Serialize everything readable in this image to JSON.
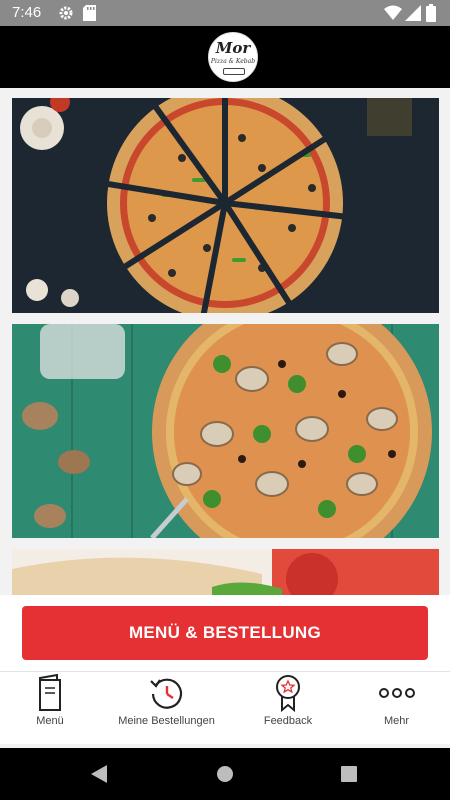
{
  "status_bar": {
    "time": "7:46",
    "icons": [
      "settings-icon",
      "sd-card-icon",
      "wifi-icon",
      "signal-icon",
      "battery-icon"
    ]
  },
  "header": {
    "logo": {
      "name": "Mor",
      "subtitle": "Pizza & Kebab"
    }
  },
  "content": {
    "cards": [
      {
        "name": "pizza-slices-photo"
      },
      {
        "name": "mushroom-pizza-photo"
      },
      {
        "name": "wrap-photo"
      }
    ]
  },
  "cta": {
    "label": "MENÜ & BESTELLUNG",
    "color": "#e53134"
  },
  "tabs": [
    {
      "label": "Menü",
      "icon": "menu-book-icon"
    },
    {
      "label": "Meine Bestellungen",
      "icon": "order-history-icon"
    },
    {
      "label": "Feedback",
      "icon": "award-ribbon-icon"
    },
    {
      "label": "Mehr",
      "icon": "more-dots-icon"
    }
  ],
  "navigation_bar": {
    "icons": [
      "back-icon",
      "home-icon",
      "recents-icon"
    ]
  }
}
